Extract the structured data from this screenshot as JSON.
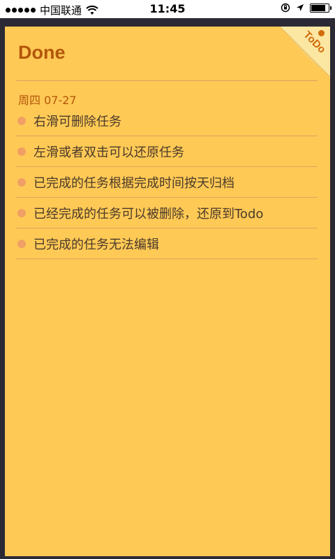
{
  "status_bar": {
    "carrier": "中国联通",
    "time": "11:45",
    "battery_level": 0.9
  },
  "page": {
    "title": "Done",
    "corner_tag": "ToDo"
  },
  "sections": [
    {
      "date": "周四 07-27",
      "items": [
        {
          "text": "右滑可删除任务"
        },
        {
          "text": "左滑或者双击可以还原任务"
        },
        {
          "text": "已完成的任务根据完成时间按天归档"
        },
        {
          "text": "已经完成的任务可以被删除，还原到Todo"
        },
        {
          "text": "已完成的任务无法编辑"
        }
      ]
    }
  ],
  "colors": {
    "note_background": "#ffc955",
    "title": "#b3560a",
    "bullet": "#f0a064",
    "frame": "#2b2a35"
  },
  "icons": [
    "signal-dots-icon",
    "wifi-icon",
    "orientation-lock-icon",
    "location-arrow-icon",
    "battery-icon",
    "corner-fold-icon"
  ]
}
